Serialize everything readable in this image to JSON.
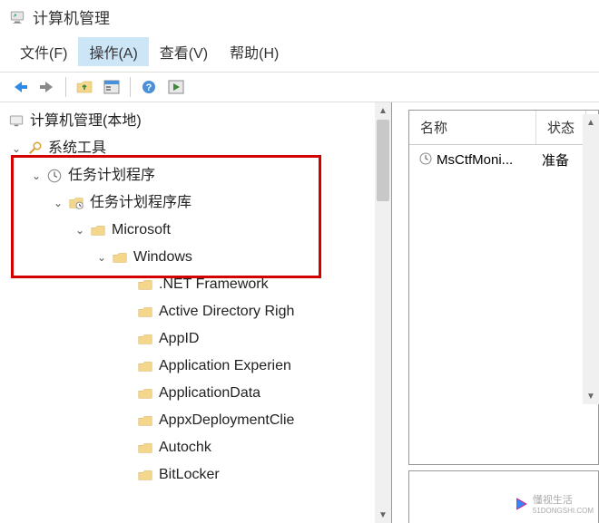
{
  "window": {
    "title": "计算机管理"
  },
  "menu": {
    "file": "文件(F)",
    "action": "操作(A)",
    "view": "查看(V)",
    "help": "帮助(H)"
  },
  "tree": {
    "root": "计算机管理(本地)",
    "sys_tools": "系统工具",
    "task_sched": "任务计划程序",
    "task_lib": "任务计划程序库",
    "microsoft": "Microsoft",
    "windows": "Windows",
    "children": [
      ".NET Framework",
      "Active Directory Righ",
      "AppID",
      "Application Experien",
      "ApplicationData",
      "AppxDeploymentClie",
      "Autochk",
      "BitLocker"
    ]
  },
  "right": {
    "col_name": "名称",
    "col_status": "状态",
    "row1_name": "MsCtfMoni...",
    "row1_status": "准备"
  },
  "watermark": {
    "text": "懂视生活",
    "domain": "51DONGSHI.COM"
  }
}
